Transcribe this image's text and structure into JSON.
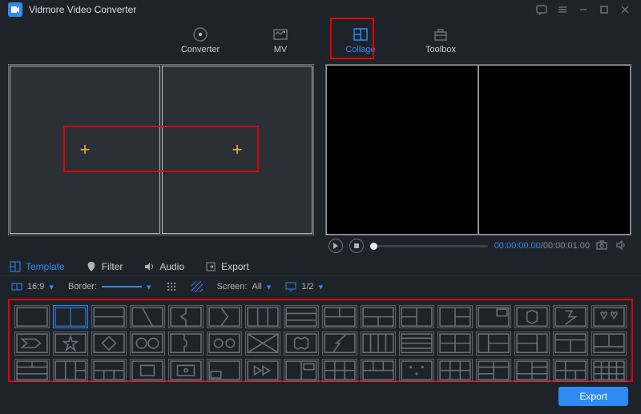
{
  "app": {
    "title": "Vidmore Video Converter"
  },
  "nav": {
    "items": [
      {
        "label": "Converter",
        "icon": "converter-icon"
      },
      {
        "label": "MV",
        "icon": "mv-icon"
      },
      {
        "label": "Collage",
        "icon": "collage-icon",
        "active": true
      },
      {
        "label": "Toolbox",
        "icon": "toolbox-icon"
      }
    ]
  },
  "player": {
    "current_time": "00:00:00.00",
    "total_time": "00:00:01.00"
  },
  "tabs": {
    "template": "Template",
    "filter": "Filter",
    "audio": "Audio",
    "export": "Export"
  },
  "options": {
    "ratio": "16:9",
    "border_label": "Border:",
    "screen_label": "Screen:",
    "screen_value": "All",
    "page": "1/2"
  },
  "footer": {
    "export": "Export"
  }
}
